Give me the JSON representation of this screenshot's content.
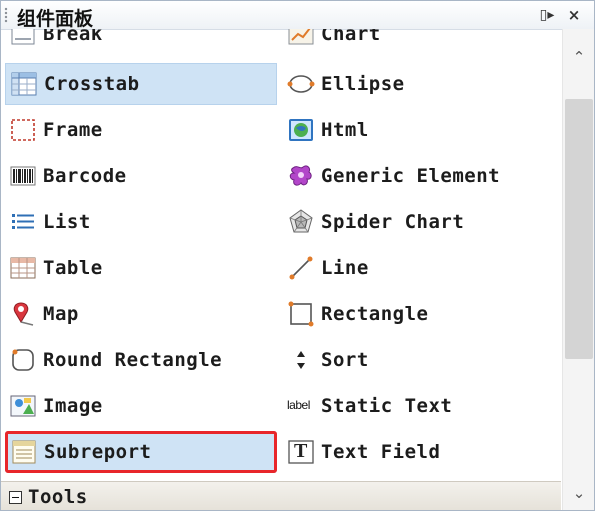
{
  "title": "组件面板",
  "title_buttons": {
    "pin_glyph": "▯▸",
    "close_glyph": "×"
  },
  "items": [
    {
      "label": "Break",
      "icon": "break-icon"
    },
    {
      "label": "Chart",
      "icon": "chart-icon"
    },
    {
      "label": "Crosstab",
      "icon": "crosstab-icon",
      "highlighted": true
    },
    {
      "label": "Ellipse",
      "icon": "ellipse-icon"
    },
    {
      "label": "Frame",
      "icon": "frame-icon"
    },
    {
      "label": "Html",
      "icon": "html-icon"
    },
    {
      "label": "Barcode",
      "icon": "barcode-icon"
    },
    {
      "label": "Generic Element",
      "icon": "generic-element-icon"
    },
    {
      "label": "List",
      "icon": "list-icon"
    },
    {
      "label": "Spider Chart",
      "icon": "spider-chart-icon"
    },
    {
      "label": "Table",
      "icon": "table-icon"
    },
    {
      "label": "Line",
      "icon": "line-icon"
    },
    {
      "label": "Map",
      "icon": "map-icon"
    },
    {
      "label": "Rectangle",
      "icon": "rectangle-icon"
    },
    {
      "label": "Round Rectangle",
      "icon": "round-rectangle-icon"
    },
    {
      "label": "Sort",
      "icon": "sort-icon"
    },
    {
      "label": "Image",
      "icon": "image-icon"
    },
    {
      "label": "Static Text",
      "icon": "static-text-icon",
      "icon_text": "label"
    },
    {
      "label": "Subreport",
      "icon": "subreport-icon",
      "highlighted": true,
      "annotated": true
    },
    {
      "label": "Text Field",
      "icon": "text-field-icon",
      "icon_text": "T"
    }
  ],
  "section": {
    "label": "Tools"
  },
  "colors": {
    "highlight": "#cfe3f5",
    "annotation": "#e8262a",
    "accent": "#e07b2a"
  }
}
